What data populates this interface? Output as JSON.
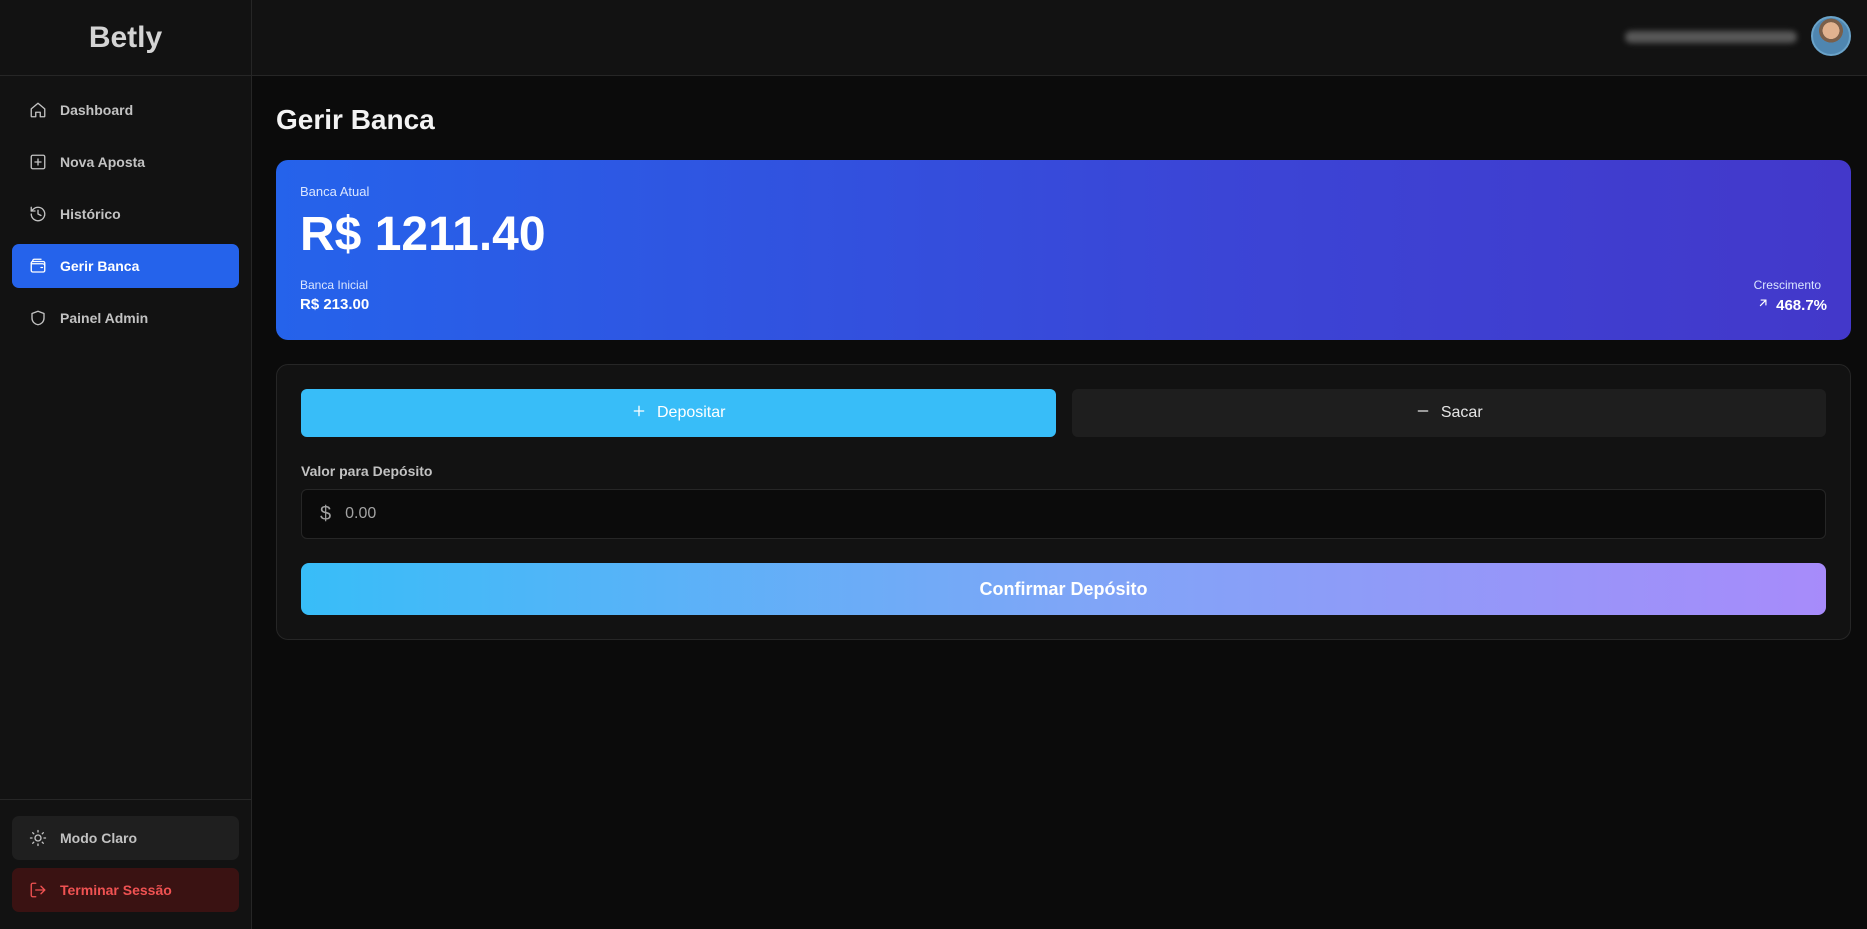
{
  "app": {
    "brand": "Betly"
  },
  "sidebar": {
    "items": [
      {
        "label": "Dashboard",
        "icon": "home-icon",
        "active": false
      },
      {
        "label": "Nova Aposta",
        "icon": "plus-square-icon",
        "active": false
      },
      {
        "label": "Histórico",
        "icon": "history-icon",
        "active": false
      },
      {
        "label": "Gerir Banca",
        "icon": "wallet-icon",
        "active": true
      },
      {
        "label": "Painel Admin",
        "icon": "shield-icon",
        "active": false
      }
    ],
    "theme_label": "Modo Claro",
    "logout_label": "Terminar Sessão"
  },
  "header": {
    "avatar_icon": "user-avatar"
  },
  "page": {
    "title": "Gerir Banca",
    "bank": {
      "current_label": "Banca Atual",
      "current_value": "R$ 1211.40",
      "initial_label": "Banca Inicial",
      "initial_value": "R$ 213.00",
      "growth_label": "Crescimento",
      "growth_value": "468.7%"
    },
    "tabs": {
      "deposit": "Depositar",
      "withdraw": "Sacar"
    },
    "field_label": "Valor para Depósito",
    "amount_placeholder": "0.00",
    "confirm_label": "Confirmar Depósito"
  },
  "colors": {
    "accent": "#2563eb",
    "deposit": "#38bdf8",
    "logout": "#f05252",
    "gradient_end": "#a78bfa"
  }
}
